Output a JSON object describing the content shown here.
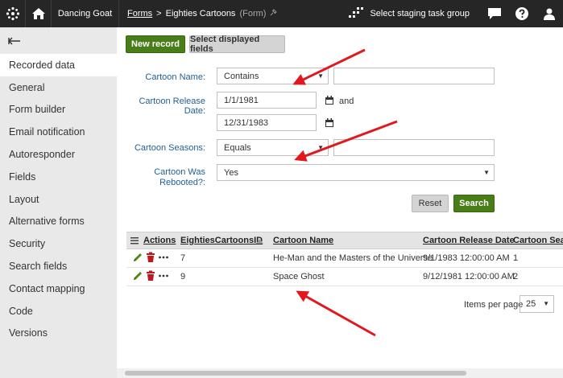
{
  "topbar": {
    "site_name": "Dancing Goat",
    "breadcrumb_root": "Forms",
    "breadcrumb_sep": ">",
    "breadcrumb_current": "Eighties Cartoons",
    "breadcrumb_suffix": "(Form)",
    "staging_label": "Select staging task group"
  },
  "sidebar": {
    "items": [
      {
        "label": "Recorded data",
        "active": true
      },
      {
        "label": "General"
      },
      {
        "label": "Form builder"
      },
      {
        "label": "Email notification"
      },
      {
        "label": "Autoresponder"
      },
      {
        "label": "Fields"
      },
      {
        "label": "Layout"
      },
      {
        "label": "Alternative forms"
      },
      {
        "label": "Security"
      },
      {
        "label": "Search fields"
      },
      {
        "label": "Contact mapping"
      },
      {
        "label": "Code"
      },
      {
        "label": "Versions"
      }
    ]
  },
  "toolbar": {
    "new_record": "New record",
    "select_fields": "Select displayed fields"
  },
  "filter": {
    "cartoon_name_label": "Cartoon Name:",
    "cartoon_name_operator": "Contains",
    "cartoon_name_value": "",
    "release_date_label": "Cartoon Release Date:",
    "release_date_from": "1/1/1981",
    "and_label": "and",
    "release_date_to": "12/31/1983",
    "seasons_label": "Cartoon Seasons:",
    "seasons_operator": "Equals",
    "seasons_value": "",
    "rebooted_label_line1": "Cartoon Was",
    "rebooted_label_line2": "Rebooted?:",
    "rebooted_value": "Yes",
    "reset": "Reset",
    "search": "Search"
  },
  "table": {
    "headers": [
      "Actions",
      "EightiesCartoonsID",
      "Cartoon Name",
      "Cartoon Release Date",
      "Cartoon Seaso"
    ],
    "rows": [
      {
        "id": "7",
        "name": "He-Man and the Masters of the Universe",
        "date": "9/1/1983 12:00:00 AM",
        "seasons": "1"
      },
      {
        "id": "9",
        "name": "Space Ghost",
        "date": "9/12/1981 12:00:00 AM",
        "seasons": "2"
      }
    ]
  },
  "pager": {
    "items_per_page_label": "Items per page",
    "items_per_page_value": "25"
  },
  "colors": {
    "accent_green": "#497d18",
    "link_blue": "#1f5f94",
    "delete_red": "#c0161d",
    "edit_green": "#4b8a12",
    "annotation_red": "#e0191f"
  }
}
